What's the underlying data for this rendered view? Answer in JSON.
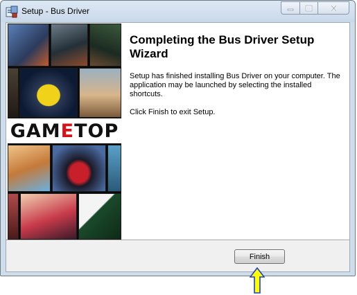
{
  "window": {
    "title": "Setup - Bus Driver",
    "controls": {
      "minimize_icon": "minimize-icon",
      "maximize_icon": "maximize-icon",
      "close_icon": "close-icon"
    }
  },
  "sidebar": {
    "brand": {
      "g": "GAM",
      "e": "E",
      "rest": "TOP"
    }
  },
  "main": {
    "heading": "Completing the Bus Driver Setup Wizard",
    "message": "Setup has finished installing Bus Driver on your computer. The application may be launched by selecting the installed shortcuts.",
    "instruction": "Click Finish to exit Setup."
  },
  "footer": {
    "finish_label": "Finish"
  },
  "colors": {
    "titlebar": "#c9d8ea",
    "brand_accent": "#d4141b",
    "arrow_fill": "#ffff00",
    "arrow_stroke": "#1a3fd0"
  }
}
